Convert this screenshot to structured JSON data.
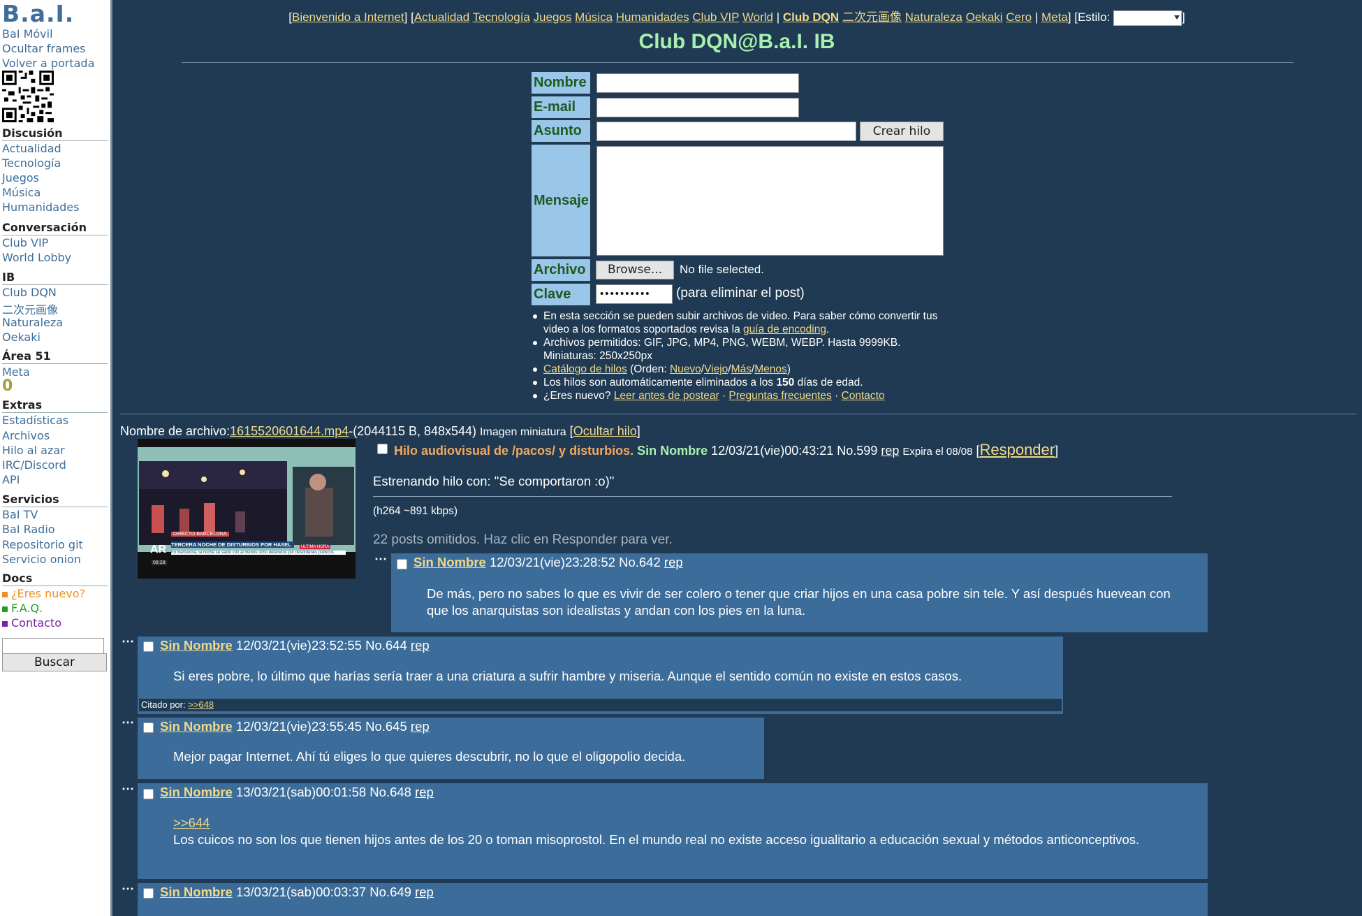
{
  "sidebar": {
    "logo": "B.a.I.",
    "top_links": [
      "BaI Móvil",
      "Ocultar frames",
      "Volver a portada"
    ],
    "sections": [
      {
        "header": "Discusión",
        "links": [
          "Actualidad",
          "Tecnología",
          "Juegos",
          "Música",
          "Humanidades"
        ]
      },
      {
        "header": "Conversación",
        "links": [
          "Club VIP",
          "World Lobby"
        ]
      },
      {
        "header": "IB",
        "links": [
          "Club DQN",
          "二次元画像",
          "Naturaleza",
          "Oekaki"
        ]
      },
      {
        "header": "Área 51",
        "links": [
          "Meta"
        ]
      },
      {
        "header": "Extras",
        "links": [
          "Estadísticas",
          "Archivos",
          "Hilo al azar",
          "IRC/Discord",
          "API"
        ]
      },
      {
        "header": "Servicios",
        "links": [
          "BaI TV",
          "BaI Radio",
          "Repositorio git",
          "Servicio onion"
        ]
      },
      {
        "header": "Docs",
        "links": [
          "¿Eres nuevo?",
          "F.A.Q.",
          "Contacto"
        ]
      }
    ],
    "counter": "0",
    "search_button": "Buscar",
    "docs_colors": [
      "#f09020",
      "#20a020",
      "#7a20a0"
    ]
  },
  "topnav": {
    "welcome": "Bienvenido a Internet",
    "boards": [
      "Actualidad",
      "Tecnología",
      "Juegos",
      "Música",
      "Humanidades",
      "Club VIP",
      "World"
    ],
    "ib_boards": [
      "Club DQN",
      "二次元画像",
      "Naturaleza",
      "Oekaki",
      "Cero"
    ],
    "meta": "Meta",
    "style_label": "[Estilo:",
    "style_value": ""
  },
  "board_title": "Club DQN@B.a.I. IB",
  "form": {
    "labels": {
      "name": "Nombre",
      "email": "E-mail",
      "subject": "Asunto",
      "message": "Mensaje",
      "file": "Archivo",
      "password": "Clave"
    },
    "create_button": "Crear hilo",
    "browse_button": "Browse...",
    "no_file": "No file selected.",
    "password_value": "••••••••••",
    "password_note": "(para eliminar el post)",
    "rules": {
      "r1_text": "En esta sección se pueden subir archivos de video. Para saber cómo convertir tus video a los formatos soportados revisa la ",
      "r1_link": "guía de encoding",
      "r2": "Archivos permitidos: GIF, JPG, MP4, PNG, WEBM, WEBP. Hasta 9999KB. Miniaturas: 250x250px",
      "r3_link": "Catálogo de hilos",
      "r3_order": "(Orden: ",
      "r3_opts": [
        "Nuevo",
        "Viejo",
        "Más",
        "Menos"
      ],
      "r4_pre": "Los hilos son automáticamente eliminados a los ",
      "r4_num": "150",
      "r4_post": " días de edad.",
      "r5_pre": "¿Eres nuevo? ",
      "r5_links": [
        "Leer antes de postear",
        "Preguntas frecuentes",
        "Contacto"
      ]
    }
  },
  "thread": {
    "file_label": "Nombre de archivo:",
    "file_name": "1615520601644.mp4",
    "file_info": "-(2044115 B, 848x544)",
    "thumb_label": "Imagen miniatura",
    "hide_thread": "Ocultar hilo",
    "subject": "Hilo audiovisual de /pacos/ y disturbios.",
    "name": "Sin Nombre",
    "date": "12/03/21(vie)00:43:21",
    "no": "No.599",
    "rep": "rep",
    "expires": "Expira el 08/08",
    "reply_link": "Responder",
    "text": "Estrenando hilo con: \"Se comportaron :o)\"",
    "codec": "(h264 ~891 kbps)",
    "omitted": "22 posts omitidos. Haz clic en Responder para ver.",
    "video_caption": "TERCERA NOCHE DE DISTURBIOS POR HASEL",
    "video_sub": "En Barcelona, la noche se saldó con al menos ocho detenidos por desórdenes públicos",
    "video_tag": "DIRECTO  BARCELONA",
    "video_live": "ÚLTIMA HORA",
    "video_logo": "AR",
    "video_time": "08:28"
  },
  "replies": [
    {
      "name": "Sin Nombre",
      "date": "12/03/21(vie)23:28:52",
      "no": "No.642",
      "rep": "rep",
      "text": "De más, pero no sabes lo que es vivir de ser colero o tener que criar hijos en una casa pobre sin tele. Y así después huevean con que los anarquistas son idealistas y andan con los pies en la luna."
    },
    {
      "name": "Sin Nombre",
      "date": "12/03/21(vie)23:52:55",
      "no": "No.644",
      "rep": "rep",
      "text": "Si eres pobre, lo último que harías sería traer a una criatura a sufrir hambre y miseria. Aunque el sentido común no existe en estos casos.",
      "cited_label": "Citado por: ",
      "cited_link": ">>648"
    },
    {
      "name": "Sin Nombre",
      "date": "12/03/21(vie)23:55:45",
      "no": "No.645",
      "rep": "rep",
      "text": "Mejor pagar Internet. Ahí tú eliges lo que quieres descubrir, no lo que el oligopolio decida."
    },
    {
      "name": "Sin Nombre",
      "date": "13/03/21(sab)00:01:58",
      "no": "No.648",
      "rep": "rep",
      "quote": ">>644",
      "text": "Los cuicos no son los que tienen hijos antes de los 20 o toman misoprostol. En el mundo real no existe acceso igualitario a educación sexual y métodos anticonceptivos."
    },
    {
      "name": "Sin Nombre",
      "date": "13/03/21(sab)00:03:37",
      "no": "No.649",
      "rep": "rep"
    }
  ],
  "colors": {
    "background": "#1f3a52",
    "reply_bg": "#3c6c9a",
    "link": "#f0d98a",
    "title": "#a8f0b0",
    "subject": "#f2a860",
    "form_label_bg": "#9ac6ea"
  }
}
